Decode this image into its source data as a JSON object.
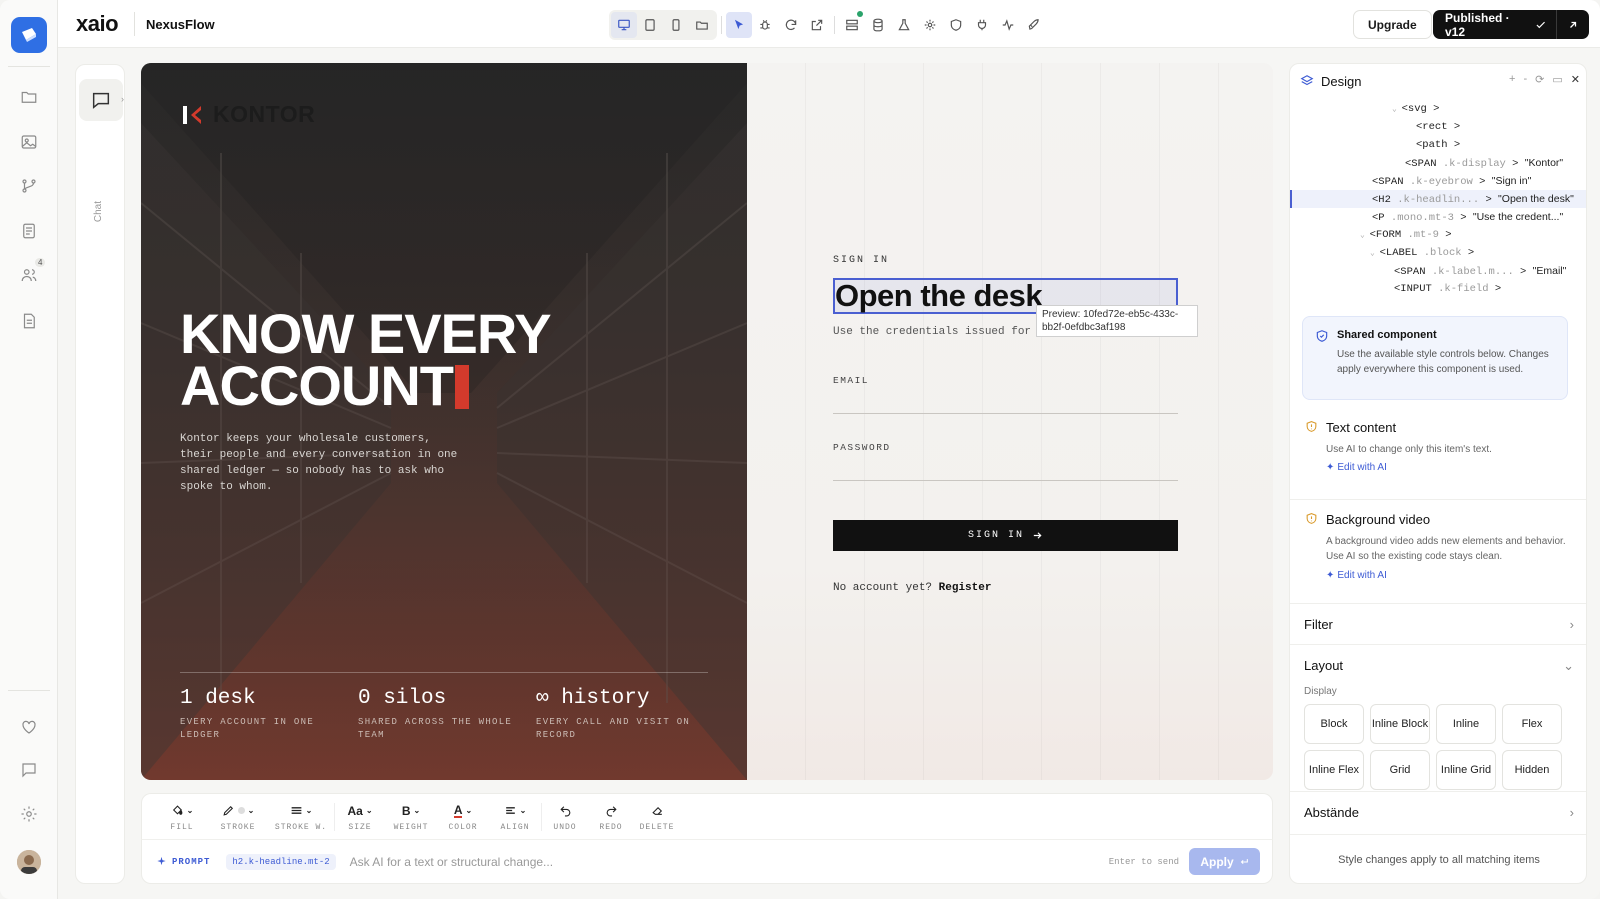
{
  "topbar": {
    "brand": "xaio",
    "project": "NexusFlow",
    "upgrade_label": "Upgrade",
    "publish_label": "Published · v12"
  },
  "rail": {
    "team_badge": "4"
  },
  "chat": {
    "label": "Chat"
  },
  "hero": {
    "brand": "KONTOR",
    "headline_line1": "KNOW EVERY",
    "headline_line2": "ACCOUNT",
    "lede": "Kontor keeps your wholesale customers, their people and every conversation in one shared ledger — so nobody has to ask who spoke to whom.",
    "stats": [
      {
        "num": "1 desk",
        "caption": "EVERY ACCOUNT IN ONE LEDGER"
      },
      {
        "num": "0 silos",
        "caption": "SHARED ACROSS THE WHOLE TEAM"
      },
      {
        "num": "∞ history",
        "caption": "EVERY CALL AND VISIT ON RECORD"
      }
    ],
    "accent": "#d33a2c"
  },
  "form": {
    "eyebrow": "SIGN IN",
    "headline": "Open the desk",
    "tooltip": "Preview: 10fed72e-eb5c-433c-bb2f-0efdbc3af198",
    "subtitle": "Use the credentials issued for your workspace.",
    "email_label": "EMAIL",
    "password_label": "PASSWORD",
    "submit_label": "SIGN IN",
    "register_prompt": "No account yet?",
    "register_link": "Register"
  },
  "format_toolbar": [
    {
      "name": "fill",
      "label": "FILL",
      "icon": "bucket-icon"
    },
    {
      "name": "stroke",
      "label": "STROKE",
      "icon": "pen-icon"
    },
    {
      "name": "stroke-width",
      "label": "STROKE W.",
      "icon": "lines-icon"
    },
    {
      "name": "size",
      "label": "SIZE",
      "icon": "Aa"
    },
    {
      "name": "weight",
      "label": "WEIGHT",
      "icon": "B"
    },
    {
      "name": "color",
      "label": "COLOR",
      "icon": "A"
    },
    {
      "name": "align",
      "label": "ALIGN",
      "icon": "align-icon"
    },
    {
      "name": "undo",
      "label": "UNDO",
      "icon": "undo-icon"
    },
    {
      "name": "redo",
      "label": "REDO",
      "icon": "redo-icon"
    },
    {
      "name": "delete",
      "label": "DELETE",
      "icon": "eraser-icon"
    }
  ],
  "prompt": {
    "tag": "PROMPT",
    "chip": "h2.k-headline.mt-2",
    "placeholder": "Ask AI for a text or structural change...",
    "hint": "Enter to send",
    "apply_label": "Apply"
  },
  "panel": {
    "title": "Design",
    "tree": [
      {
        "tag": "<svg",
        "cls": "",
        "text": ""
      },
      {
        "tag": "<rect",
        "cls": "",
        "text": ""
      },
      {
        "tag": "<path",
        "cls": "",
        "text": ""
      },
      {
        "tag": "<SPAN",
        "cls": ".k-display",
        "text": "\"Kontor\""
      },
      {
        "tag": "<SPAN",
        "cls": ".k-eyebrow",
        "text": "\"Sign in\""
      },
      {
        "tag": "<H2",
        "cls": ".k-headlin...",
        "text": "\"Open the desk\""
      },
      {
        "tag": "<P",
        "cls": ".mono.mt-3",
        "text": "\"Use the credent...\""
      },
      {
        "tag": "<FORM",
        "cls": ".mt-9",
        "text": ""
      },
      {
        "tag": "<LABEL",
        "cls": ".block",
        "text": ""
      },
      {
        "tag": "<SPAN",
        "cls": ".k-label.m...",
        "text": "\"Email\""
      },
      {
        "tag": "<INPUT",
        "cls": ".k-field",
        "text": ""
      }
    ],
    "shared_title": "Shared component",
    "shared_desc": "Use the available style controls below. Changes apply everywhere this component is used.",
    "text_content_title": "Text content",
    "text_content_desc": "Use AI to change only this item's text.",
    "edit_ai_label": "Edit with AI",
    "bg_video_title": "Background video",
    "bg_video_desc": "A background video adds new elements and behavior. Use AI so the existing code stays clean.",
    "filter_label": "Filter",
    "layout_label": "Layout",
    "display_label": "Display",
    "display_options": [
      "Block",
      "Inline Block",
      "Inline",
      "Flex",
      "Inline Flex",
      "Grid",
      "Inline Grid",
      "Hidden"
    ],
    "spacing_label": "Abstände",
    "footer": "Style changes apply to all matching items"
  }
}
